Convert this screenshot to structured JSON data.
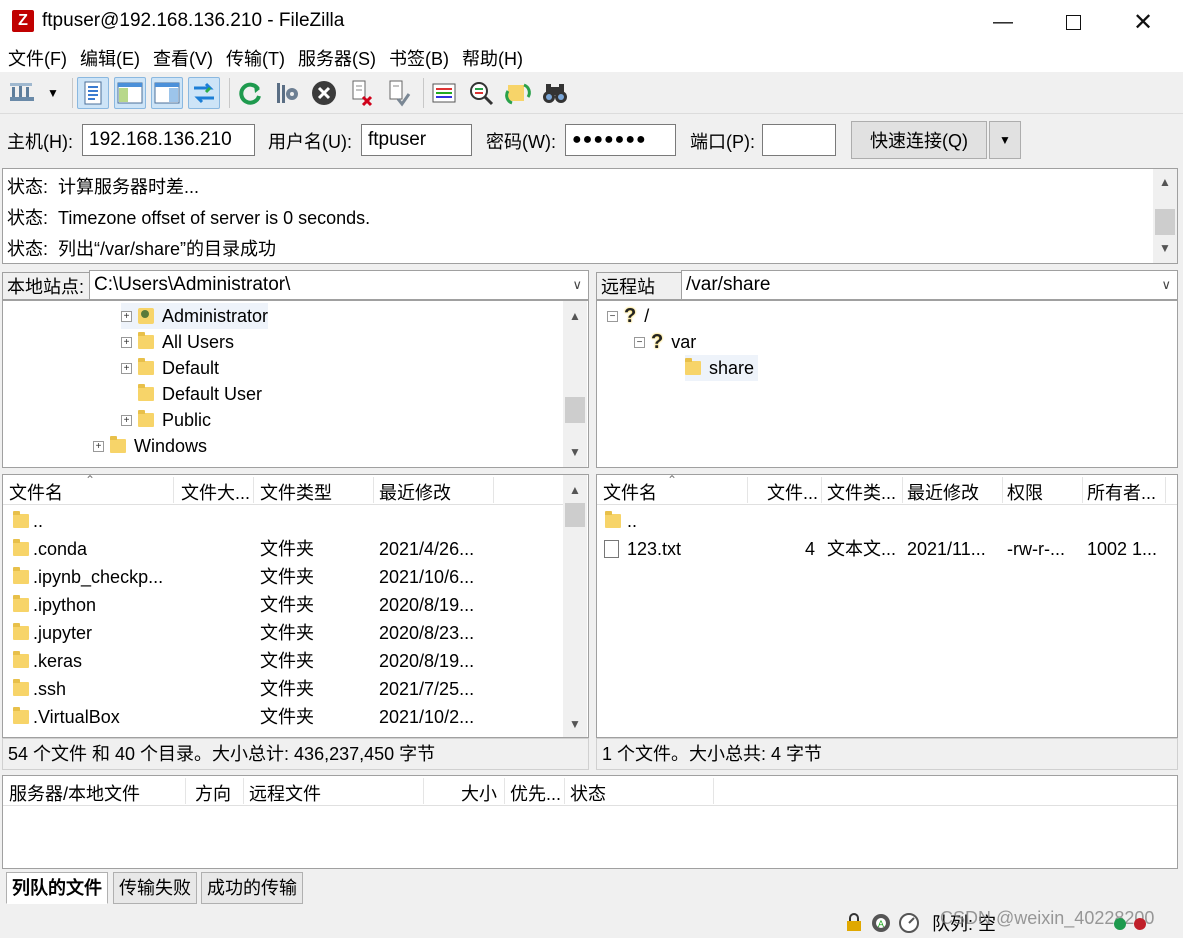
{
  "window": {
    "title": "ftpuser@192.168.136.210 - FileZilla",
    "app_icon": "Z"
  },
  "menu": [
    "文件(F)",
    "编辑(E)",
    "查看(V)",
    "传输(T)",
    "服务器(S)",
    "书签(B)",
    "帮助(H)"
  ],
  "toolbar": {
    "icons": [
      "site-manager-icon",
      "dropdown-arrow-icon",
      "toggle-log-icon",
      "toggle-local-tree-icon",
      "toggle-remote-tree-icon",
      "toggle-queue-icon",
      "refresh-icon",
      "process-queue-icon",
      "cancel-icon",
      "disconnect-icon",
      "reconnect-icon",
      "filter-icon",
      "compare-icon",
      "sync-browse-icon",
      "search-icon"
    ]
  },
  "quickconnect": {
    "host_label": "主机(H):",
    "host_value": "192.168.136.210",
    "user_label": "用户名(U):",
    "user_value": "ftpuser",
    "pass_label": "密码(W):",
    "pass_value": "●●●●●●●",
    "port_label": "端口(P):",
    "port_value": "",
    "connect_label": "快速连接(Q)"
  },
  "log": [
    {
      "label": "状态:",
      "text": "计算服务器时差..."
    },
    {
      "label": "状态:",
      "text": "Timezone offset of server is 0 seconds."
    },
    {
      "label": "状态:",
      "text": "列出“/var/share”的目录成功"
    }
  ],
  "local": {
    "site_label": "本地站点:",
    "path": "C:\\Users\\Administrator\\",
    "tree": [
      {
        "name": "Administrator",
        "expander": "+",
        "icon": "user-folder"
      },
      {
        "name": "All Users",
        "expander": "+"
      },
      {
        "name": "Default",
        "expander": "+"
      },
      {
        "name": "Default User",
        "expander": ""
      },
      {
        "name": "Public",
        "expander": "+"
      },
      {
        "name": "Windows",
        "expander": "+"
      }
    ],
    "headers": [
      "文件名",
      "文件大...",
      "文件类型",
      "最近修改"
    ],
    "files": [
      {
        "name": "..",
        "type": "",
        "modified": ""
      },
      {
        "name": ".conda",
        "type": "文件夹",
        "modified": "2021/4/26..."
      },
      {
        "name": ".ipynb_checkp...",
        "type": "文件夹",
        "modified": "2021/10/6..."
      },
      {
        "name": ".ipython",
        "type": "文件夹",
        "modified": "2020/8/19..."
      },
      {
        "name": ".jupyter",
        "type": "文件夹",
        "modified": "2020/8/23..."
      },
      {
        "name": ".keras",
        "type": "文件夹",
        "modified": "2020/8/19..."
      },
      {
        "name": ".ssh",
        "type": "文件夹",
        "modified": "2021/7/25..."
      },
      {
        "name": ".VirtualBox",
        "type": "文件夹",
        "modified": "2021/10/2..."
      }
    ],
    "status": "54 个文件 和 40 个目录。大小总计: 436,237,450 字节"
  },
  "remote": {
    "site_label": "远程站点:",
    "path": "/var/share",
    "tree": [
      {
        "name": "/",
        "expander": "−"
      },
      {
        "name": "var",
        "expander": "−"
      },
      {
        "name": "share",
        "expander": ""
      }
    ],
    "headers": [
      "文件名",
      "文件...",
      "文件类...",
      "最近修改",
      "权限",
      "所有者..."
    ],
    "files": [
      {
        "name": "..",
        "size": "",
        "type": "",
        "modified": "",
        "perms": "",
        "owner": ""
      },
      {
        "name": "123.txt",
        "size": "4",
        "type": "文本文...",
        "modified": "2021/11...",
        "perms": "-rw-r-...",
        "owner": "1002 1..."
      }
    ],
    "status": "1 个文件。大小总共: 4 字节"
  },
  "queue": {
    "headers": [
      "服务器/本地文件",
      "方向",
      "远程文件",
      "大小",
      "优先...",
      "状态"
    ],
    "tabs": [
      "列队的文件",
      "传输失败",
      "成功的传输"
    ],
    "status": "队列: 空",
    "watermark": "CSDN @weixin_40228200"
  }
}
